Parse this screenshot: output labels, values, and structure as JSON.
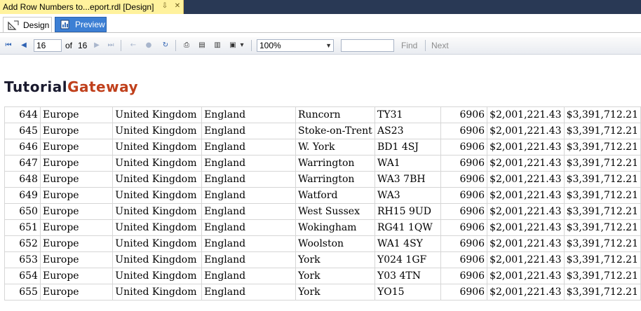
{
  "document_tab": {
    "title": "Add Row Numbers to...eport.rdl [Design]",
    "pin_icon": "pin-icon",
    "close_icon": "close-icon"
  },
  "mode_tabs": [
    {
      "label": "Design",
      "icon": "design-ruler-icon",
      "active": false
    },
    {
      "label": "Preview",
      "icon": "preview-report-icon",
      "active": true
    }
  ],
  "toolbar": {
    "page_current": "16",
    "of_label": "of",
    "page_total": "16",
    "zoom": "100%",
    "find_value": "",
    "find_label": "Find",
    "next_label": "Next"
  },
  "logo": {
    "part1": "Tutorial",
    "part2": "Gateway"
  },
  "colors": {
    "accent": "#3c7fd4",
    "doc_tab": "#fff29d",
    "title_bar": "#293955",
    "logo_dark": "#1a1a2e",
    "logo_accent": "#c0401c"
  },
  "rows": [
    {
      "no": "644",
      "region": "Europe",
      "country": "United Kingdom",
      "state": "England",
      "city": "Runcorn",
      "postal": "TY31",
      "qty": "6906",
      "amount1": "$2,001,221.43",
      "amount2": "$3,391,712.21"
    },
    {
      "no": "645",
      "region": "Europe",
      "country": "United Kingdom",
      "state": "England",
      "city": "Stoke-on-Trent",
      "postal": "AS23",
      "qty": "6906",
      "amount1": "$2,001,221.43",
      "amount2": "$3,391,712.21"
    },
    {
      "no": "646",
      "region": "Europe",
      "country": "United Kingdom",
      "state": "England",
      "city": "W. York",
      "postal": "BD1 4SJ",
      "qty": "6906",
      "amount1": "$2,001,221.43",
      "amount2": "$3,391,712.21"
    },
    {
      "no": "647",
      "region": "Europe",
      "country": "United Kingdom",
      "state": "England",
      "city": "Warrington",
      "postal": "WA1",
      "qty": "6906",
      "amount1": "$2,001,221.43",
      "amount2": "$3,391,712.21"
    },
    {
      "no": "648",
      "region": "Europe",
      "country": "United Kingdom",
      "state": "England",
      "city": "Warrington",
      "postal": "WA3 7BH",
      "qty": "6906",
      "amount1": "$2,001,221.43",
      "amount2": "$3,391,712.21"
    },
    {
      "no": "649",
      "region": "Europe",
      "country": "United Kingdom",
      "state": "England",
      "city": "Watford",
      "postal": "WA3",
      "qty": "6906",
      "amount1": "$2,001,221.43",
      "amount2": "$3,391,712.21"
    },
    {
      "no": "650",
      "region": "Europe",
      "country": "United Kingdom",
      "state": "England",
      "city": "West Sussex",
      "postal": "RH15 9UD",
      "qty": "6906",
      "amount1": "$2,001,221.43",
      "amount2": "$3,391,712.21"
    },
    {
      "no": "651",
      "region": "Europe",
      "country": "United Kingdom",
      "state": "England",
      "city": "Wokingham",
      "postal": "RG41 1QW",
      "qty": "6906",
      "amount1": "$2,001,221.43",
      "amount2": "$3,391,712.21"
    },
    {
      "no": "652",
      "region": "Europe",
      "country": "United Kingdom",
      "state": "England",
      "city": "Woolston",
      "postal": "WA1 4SY",
      "qty": "6906",
      "amount1": "$2,001,221.43",
      "amount2": "$3,391,712.21"
    },
    {
      "no": "653",
      "region": "Europe",
      "country": "United Kingdom",
      "state": "England",
      "city": "York",
      "postal": "Y024 1GF",
      "qty": "6906",
      "amount1": "$2,001,221.43",
      "amount2": "$3,391,712.21"
    },
    {
      "no": "654",
      "region": "Europe",
      "country": "United Kingdom",
      "state": "England",
      "city": "York",
      "postal": "Y03 4TN",
      "qty": "6906",
      "amount1": "$2,001,221.43",
      "amount2": "$3,391,712.21"
    },
    {
      "no": "655",
      "region": "Europe",
      "country": "United Kingdom",
      "state": "England",
      "city": "York",
      "postal": "YO15",
      "qty": "6906",
      "amount1": "$2,001,221.43",
      "amount2": "$3,391,712.21"
    }
  ]
}
